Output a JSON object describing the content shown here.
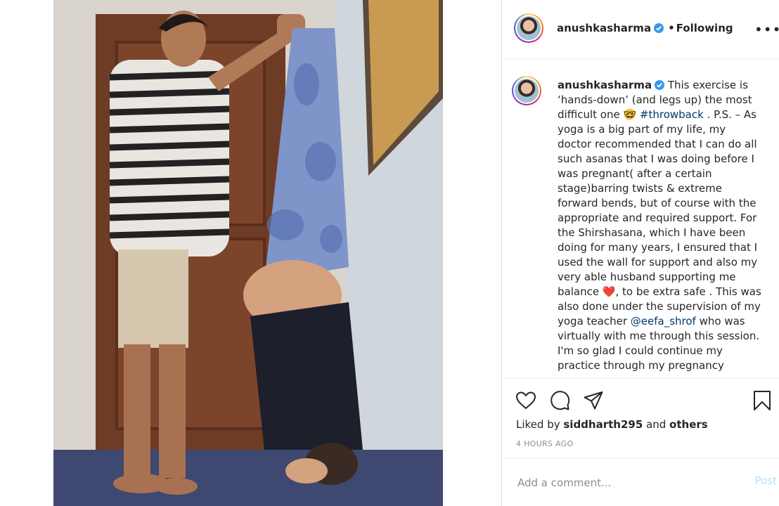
{
  "post": {
    "username": "anushkasharma",
    "separator": "•",
    "follow_status": "Following",
    "more_label": "•••"
  },
  "caption": {
    "username": "anushkasharma",
    "text_1": " This exercise is ‘hands-down’ (and legs up) the most difficult one ",
    "emoji_1": "🤓",
    "hashtag": "#throwback",
    "text_2": " . P.S. – As yoga is a big part of my life, my doctor recommended that I can do all such asanas that I was doing before I was pregnant( after a certain stage)barring twists & extreme forward bends, but of course with the appropriate and required support. For the Shirshasana, which I have been doing for many years, I ensured that I used the wall for support and also my very able husband supporting me balance ",
    "emoji_2": "❤️",
    "text_3": ", to be extra safe . This was also done under the supervision of my yoga teacher ",
    "mention": "@eefa_shrof",
    "text_4": " who was virtually with me through this session. I'm so glad I could continue my practice through my pregnancy"
  },
  "engagement": {
    "liked_prefix": "Liked by ",
    "liked_user": "siddharth295",
    "liked_and": " and ",
    "liked_others": "others",
    "timestamp": "4 HOURS AGO"
  },
  "comment": {
    "placeholder": "Add a comment...",
    "post_label": "Post"
  },
  "colors": {
    "link": "#00376b",
    "verified": "#3897f0",
    "post_disabled": "#b2dffc"
  },
  "icons": [
    "verified-badge-icon",
    "heart-icon",
    "comment-icon",
    "share-icon",
    "bookmark-icon",
    "more-options-icon"
  ]
}
